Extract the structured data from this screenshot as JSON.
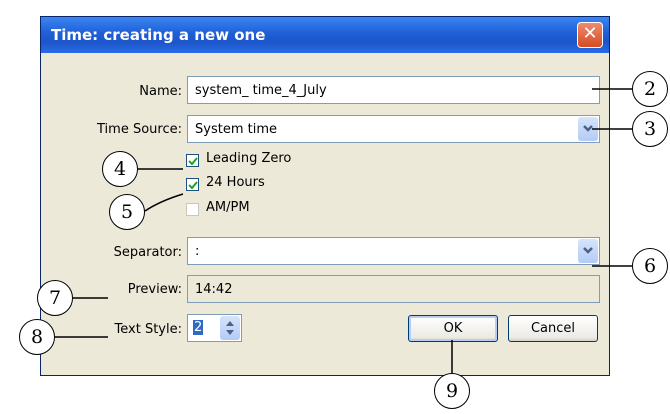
{
  "window": {
    "title": "Time: creating a new one",
    "close_glyph": "✕"
  },
  "form": {
    "name_label": "Name:",
    "name_value": "system_ time_4_July",
    "time_source_label": "Time Source:",
    "time_source_value": "System time",
    "leading_zero_label": "Leading Zero",
    "leading_zero_checked": true,
    "hours24_label": "24 Hours",
    "hours24_checked": true,
    "ampm_label": "AM/PM",
    "ampm_checked": false,
    "separator_label": "Separator:",
    "separator_value": ":",
    "preview_label": "Preview:",
    "preview_value": "14:42",
    "text_style_label": "Text Style:",
    "text_style_value": "2"
  },
  "buttons": {
    "ok_label": "OK",
    "cancel_label": "Cancel"
  },
  "callouts": {
    "c2": "2",
    "c3": "3",
    "c4": "4",
    "c5": "5",
    "c6": "6",
    "c7": "7",
    "c8": "8",
    "c9": "9"
  },
  "icons": {
    "dropdown": "chevron-down-icon",
    "spinner": "up-down-arrows-icon",
    "check": "checkmark-icon"
  },
  "colors": {
    "title_bar": "#1f5fd6",
    "close_button": "#d64b24",
    "dialog_bg": "#ece9d8",
    "check_mark": "#21a121"
  }
}
